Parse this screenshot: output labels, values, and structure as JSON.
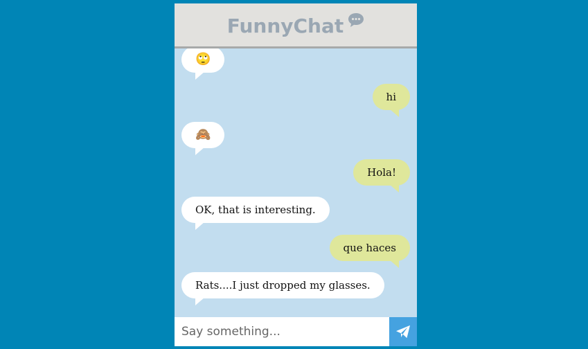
{
  "app": {
    "title": "FunnyChat",
    "title_icon": "chat-bubble-icon"
  },
  "messages": [
    {
      "side": "left",
      "kind": "emoji",
      "text": "🙄",
      "icon": "face-with-rolling-eyes-emoji"
    },
    {
      "side": "right",
      "kind": "text",
      "text": "hi"
    },
    {
      "side": "left",
      "kind": "emoji",
      "text": "🙈",
      "icon": "see-no-evil-monkey-emoji"
    },
    {
      "side": "right",
      "kind": "text",
      "text": "Hola!"
    },
    {
      "side": "left",
      "kind": "text",
      "text": "OK, that is interesting."
    },
    {
      "side": "right",
      "kind": "text",
      "text": "que haces"
    },
    {
      "side": "left",
      "kind": "text",
      "text": "Rats....I just dropped my glasses."
    }
  ],
  "composer": {
    "placeholder": "Say something...",
    "value": "",
    "send_icon": "paper-plane-icon"
  },
  "colors": {
    "page_background": "#0085b6",
    "chat_background": "#c2ddef",
    "header_background": "#e2e1de",
    "title_color": "#9aa7b3",
    "bubble_incoming": "#ffffff",
    "bubble_outgoing": "#dfe79b",
    "send_button": "#45a2e0"
  }
}
